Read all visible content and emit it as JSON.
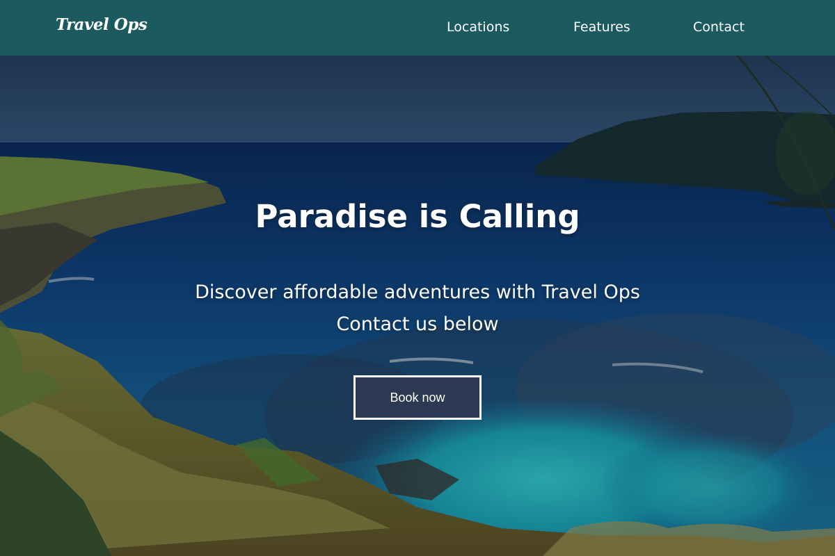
{
  "navbar": {
    "logo": "Travel Ops",
    "links": [
      {
        "label": "Locations"
      },
      {
        "label": "Features"
      },
      {
        "label": "Contact"
      }
    ],
    "background_color": "#1b5b5f"
  },
  "hero": {
    "title": "Paradise is Calling",
    "subtitle_line1": "Discover affordable adventures with Travel Ops",
    "subtitle_line2": "Contact us below",
    "cta_label": "Book now",
    "cta_color": "#2b3a52",
    "background_image": "tropical-bay-photo"
  }
}
